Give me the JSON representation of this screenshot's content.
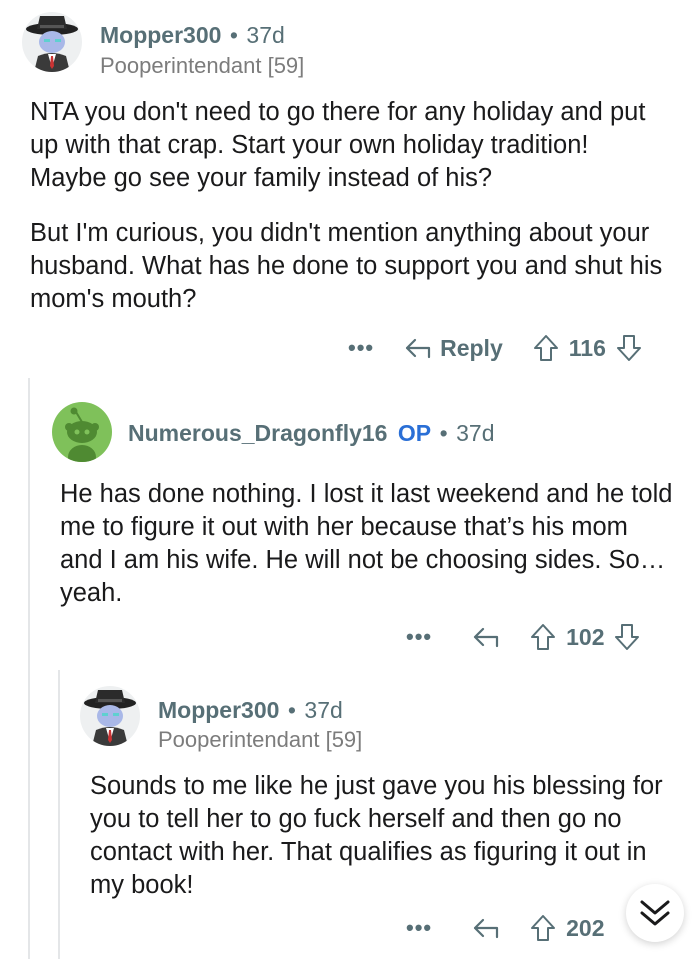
{
  "comments": [
    {
      "author": "Mopper300",
      "age": "37d",
      "flair": "Pooperintendant [59]",
      "paragraphs": [
        "NTA you don't need to go there for any holiday and put up with that crap. Start your own holiday tradition! Maybe go see your family instead of his?",
        "But I'm curious, you didn't mention anything about your husband. What has he done to support you and shut his mom's mouth?"
      ],
      "reply_label": "Reply",
      "score": "116"
    },
    {
      "author": "Numerous_Dragonfly16",
      "op_badge": "OP",
      "age": "37d",
      "paragraphs": [
        "He has done nothing. I lost it last weekend and he told me to figure it out with her because that’s his mom and I am his wife. He will not be choosing sides. So… yeah."
      ],
      "score": "102"
    },
    {
      "author": "Mopper300",
      "age": "37d",
      "flair": "Pooperintendant [59]",
      "paragraphs": [
        "Sounds to me like he just gave you his blessing for you to tell her to go fuck herself and then go no contact with her. That qualifies as figuring it out in my book!"
      ],
      "score": "202"
    }
  ],
  "separator": "•",
  "more_dots": "•••",
  "colors": {
    "username": "#576f76",
    "op": "#2a6fd6",
    "avatar_green": "#7fc15a",
    "thread_line": "#e4e6e8"
  }
}
